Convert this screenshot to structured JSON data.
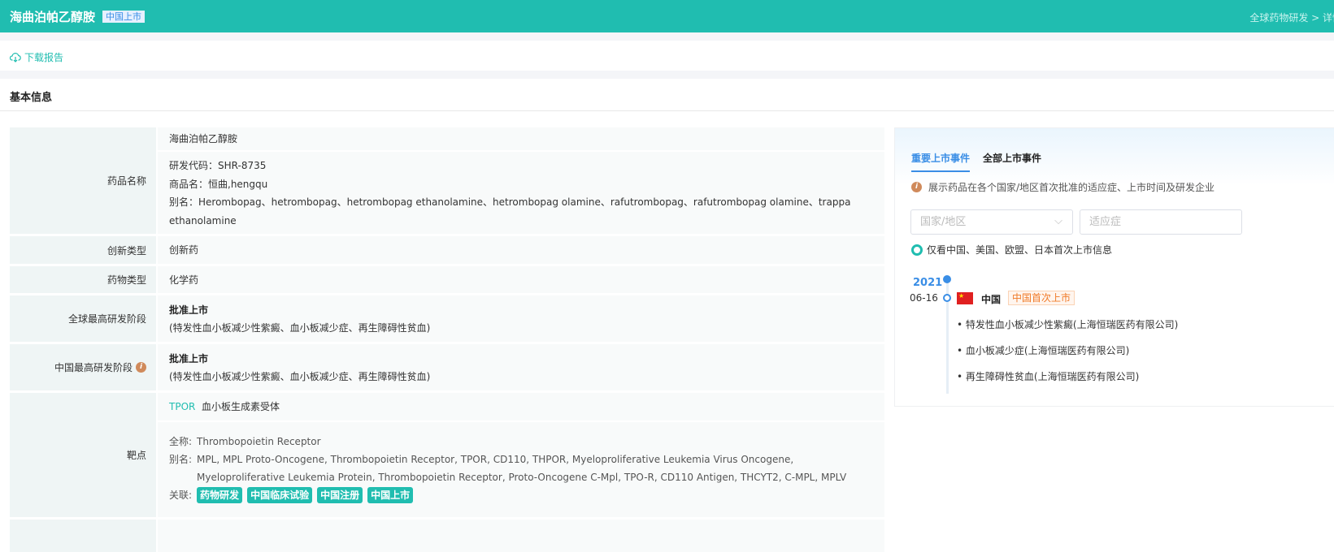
{
  "header": {
    "title": "海曲泊帕乙醇胺",
    "badge": "中国上市",
    "breadcrumb": "全球药物研发 > 详情"
  },
  "toolbar": {
    "download": "下载报告"
  },
  "section": {
    "title": "基本信息"
  },
  "rows": {
    "name": {
      "label": "药品名称",
      "generic": "海曲泊帕乙醇胺",
      "code": "研发代码：SHR-8735",
      "trade": "商品名：恒曲,hengqu",
      "alias": "别名：Herombopag、hetrombopag、hetrombopag ethanolamine、hetrombopag olamine、rafutrombopag、rafutrombopag olamine、trappa ethanolamine"
    },
    "innovation": {
      "label": "创新类型",
      "value": "创新药"
    },
    "drugtype": {
      "label": "药物类型",
      "value": "化学药"
    },
    "global": {
      "label": "全球最高研发阶段",
      "stage": "批准上市",
      "detail": "(特发性血小板减少性紫癜、血小板减少症、再生障碍性贫血)"
    },
    "china": {
      "label": "中国最高研发阶段",
      "stage": "批准上市",
      "detail": "(特发性血小板减少性紫癜、血小板减少症、再生障碍性贫血)"
    },
    "target": {
      "label": "靶点",
      "code": "TPOR",
      "name": "血小板生成素受体",
      "fullname_label": "全称:",
      "fullname": "Thrombopoietin Receptor",
      "alias_label": "别名:",
      "alias": "MPL, MPL Proto-Oncogene, Thrombopoietin Receptor, TPOR, CD110, THPOR, Myeloproliferative Leukemia Virus Oncogene, Myeloproliferative Leukemia Protein, Thrombopoietin Receptor, Proto-Oncogene C-Mpl, TPO-R, CD110 Antigen, THCYT2, C-MPL, MPLV",
      "related_label": "关联:",
      "related": [
        "药物研发",
        "中国临床试验",
        "中国注册",
        "中国上市"
      ]
    }
  },
  "panel": {
    "tabs": [
      "重要上市事件",
      "全部上市事件"
    ],
    "note": "展示药品在各个国家/地区首次批准的适应症、上市时间及研发企业",
    "country_placeholder": "国家/地区",
    "indication_placeholder": "适应症",
    "radio": "仅看中国、美国、欧盟、日本首次上市信息",
    "event": {
      "year": "2021",
      "date": "06-16",
      "country": "中国",
      "tag": "中国首次上市",
      "indications": [
        "特发性血小板减少性紫癜(上海恒瑞医药有限公司)",
        "血小板减少症(上海恒瑞医药有限公司)",
        "再生障碍性贫血(上海恒瑞医药有限公司)"
      ]
    }
  },
  "colors": {
    "brand": "#20bdb0",
    "accent": "#3a8ee6"
  }
}
